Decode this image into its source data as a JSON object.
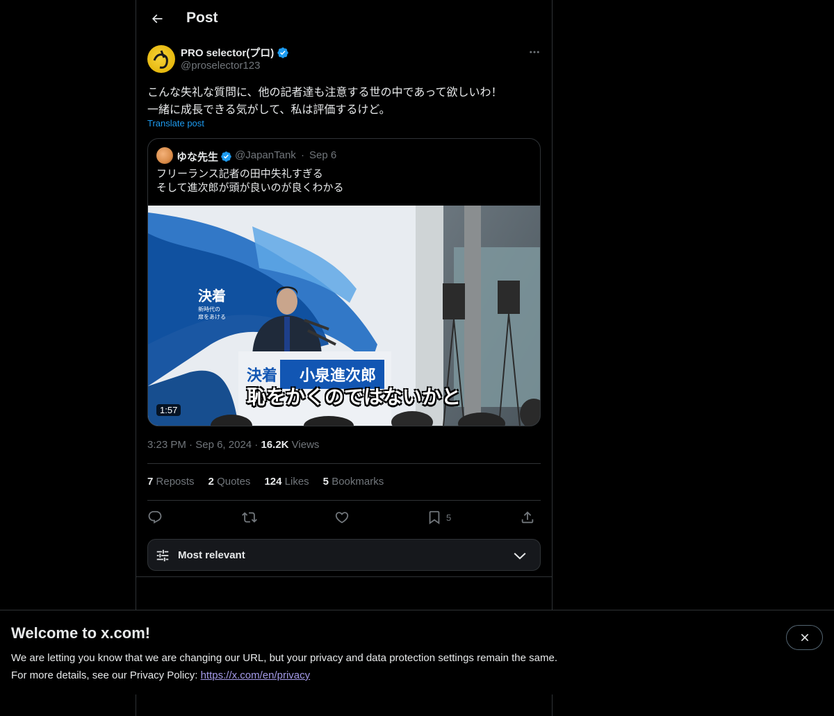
{
  "header": {
    "title": "Post"
  },
  "post": {
    "author_name": "PRO selector(プロ)",
    "author_handle": "@proselector123",
    "text": "こんな失礼な質問に、他の記者達も注意する世の中であって欲しいわ！\n一緒に成長できる気がして、私は評価するけど。",
    "translate_label": "Translate post",
    "time": "3:23 PM",
    "date": "Sep 6, 2024",
    "views_count": "16.2K",
    "views_label": "Views"
  },
  "quote": {
    "author_name": "ゆな先生",
    "author_handle": "@JapanTank",
    "separator": "·",
    "date": "Sep 6",
    "text": "フリーランス記者の田中失礼すぎる\nそして進次郎が頭が良いのが良くわかる",
    "video": {
      "duration": "1:57",
      "caption": "恥をかくのではないかと",
      "backdrop_big": "決着",
      "backdrop_small_1": "新時代の",
      "backdrop_small_2": "扉をあける",
      "podium_left": "決着",
      "podium_name": "小泉進次郎"
    }
  },
  "stats": {
    "reposts_count": "7",
    "reposts_label": "Reposts",
    "quotes_count": "2",
    "quotes_label": "Quotes",
    "likes_count": "124",
    "likes_label": "Likes",
    "bookmarks_count": "5",
    "bookmarks_label": "Bookmarks"
  },
  "actions": {
    "bookmark_count": "5"
  },
  "sort": {
    "label": "Most relevant"
  },
  "banner": {
    "title": "Welcome to x.com!",
    "line1": "We are letting you know that we are changing our URL, but your privacy and data protection settings remain the same.",
    "line2_prefix": "For more details, see our Privacy Policy: ",
    "link": "https://x.com/en/privacy"
  },
  "colors": {
    "accent": "#1d9bf0",
    "verified": "#1d9bf0",
    "background": "#000000",
    "muted_text": "#71767b",
    "link_visited": "#a49ae8"
  },
  "icons": [
    "back-arrow-icon",
    "verified-badge-icon",
    "more-icon",
    "reply-icon",
    "repost-icon",
    "like-icon",
    "bookmark-icon",
    "share-icon",
    "filter-icon",
    "chevron-down-icon",
    "close-icon"
  ]
}
